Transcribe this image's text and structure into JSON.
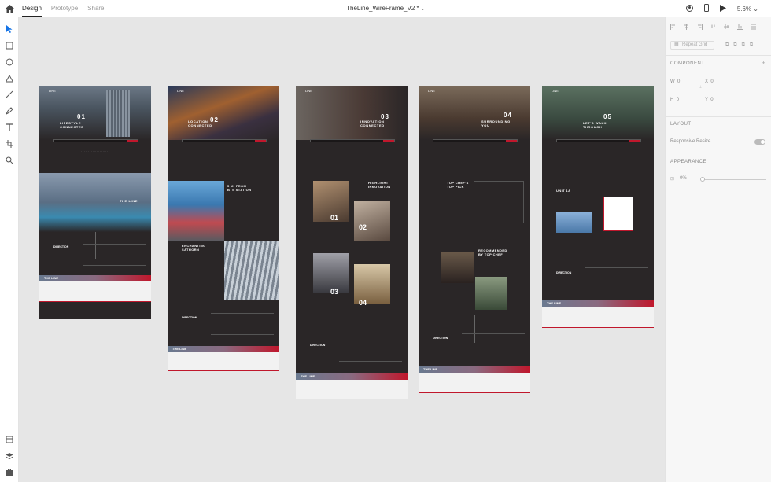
{
  "topbar": {
    "tabs": [
      "Design",
      "Prototype",
      "Share"
    ],
    "active_tab": "Design",
    "doc_title": "TheLine_WireFrame_V2 *",
    "zoom": "5.6%"
  },
  "rightbar": {
    "repeat_grid": "Repeat Grid",
    "component_heading": "COMPONENT",
    "w_label": "W",
    "w_value": "0",
    "x_label": "X",
    "x_value": "0",
    "h_label": "H",
    "h_value": "0",
    "y_label": "Y",
    "y_value": "0",
    "layout_heading": "LAYOUT",
    "responsive_resize": "Responsive Resize",
    "appearance_heading": "APPEARANCE",
    "opacity": "0%"
  },
  "artboards": [
    {
      "num": "01",
      "title": "LIFESTYLE\nCONNECTED",
      "feature": "THE LINE",
      "hero": "city"
    },
    {
      "num": "02",
      "title": "LOCATION\nCONNECTED",
      "feature": "5 M. FROM\nBTS STATION",
      "feature2": "ENCHANTING\nSATHORN",
      "hero": "city2"
    },
    {
      "num": "03",
      "title": "INNOVATION\nCONNECTED",
      "feature": "HIGHLIGHT\nINNOVATION",
      "hero": "corr"
    },
    {
      "num": "04",
      "title": "SURROUNDING\nYOU",
      "feature": "TOP CHEF'S\nTOP PICK",
      "feature2": "RECOMMENDED\nBY TOP CHEF",
      "hero": "food"
    },
    {
      "num": "05",
      "title": "LET'S WALK\nTHROUGH",
      "feature": "UNIT 1A",
      "hero": "green"
    }
  ],
  "labels": {
    "direction": "DIRECTION",
    "brand": "LINE",
    "footer_brand": "THE LINE"
  },
  "colors": {
    "accent": "#c0172c",
    "artboard_bg": "#2a2627",
    "canvas": "#e6e6e6"
  }
}
